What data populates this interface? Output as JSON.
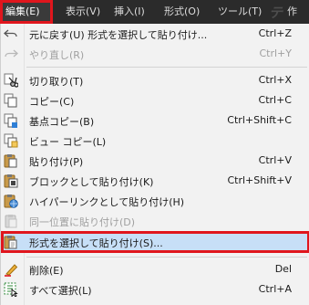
{
  "menubar": {
    "items": [
      {
        "label": "編集(E)",
        "active": true
      },
      {
        "label": "表示(V)"
      },
      {
        "label": "挿入(I)"
      },
      {
        "label": "形式(O)"
      },
      {
        "label": "ツール(T)"
      },
      {
        "label": "作"
      }
    ],
    "watermark": "テ"
  },
  "menu": {
    "items": [
      {
        "label": "元に戻す(U) 形式を選択して貼り付け...",
        "shortcut": "Ctrl+Z",
        "icon": "undo-icon",
        "enabled": true
      },
      {
        "label": "やり直し(R)",
        "shortcut": "Ctrl+Y",
        "icon": "redo-icon",
        "enabled": false
      },
      {
        "label": "切り取り(T)",
        "shortcut": "Ctrl+X",
        "icon": "scissors-icon",
        "enabled": true
      },
      {
        "label": "コピー(C)",
        "shortcut": "Ctrl+C",
        "icon": "copy-icon",
        "enabled": true
      },
      {
        "label": "基点コピー(B)",
        "shortcut": "Ctrl+Shift+C",
        "icon": "copy-with-basepoint-icon",
        "enabled": true
      },
      {
        "label": "ビュー コピー(L)",
        "shortcut": "",
        "icon": "view-copy-icon",
        "enabled": true
      },
      {
        "label": "貼り付け(P)",
        "shortcut": "Ctrl+V",
        "icon": "paste-icon",
        "enabled": true
      },
      {
        "label": "ブロックとして貼り付け(K)",
        "shortcut": "Ctrl+Shift+V",
        "icon": "paste-as-block-icon",
        "enabled": true
      },
      {
        "label": "ハイパーリンクとして貼り付け(H)",
        "shortcut": "",
        "icon": "paste-hyperlink-icon",
        "enabled": true
      },
      {
        "label": "同一位置に貼り付け(D)",
        "shortcut": "",
        "icon": "paste-original-coords-icon",
        "enabled": false
      },
      {
        "label": "形式を選択して貼り付け(S)...",
        "shortcut": "",
        "icon": "paste-special-icon",
        "enabled": true,
        "highlighted": true
      },
      {
        "label": "削除(E)",
        "shortcut": "Del",
        "icon": "eraser-icon",
        "enabled": true
      },
      {
        "label": "すべて選択(L)",
        "shortcut": "Ctrl+A",
        "icon": "select-all-icon",
        "enabled": true
      }
    ]
  },
  "colors": {
    "highlight": "#c7dff7",
    "annotation_border": "#e0161d",
    "menubar_bg": "#2b2b2b",
    "menu_bg": "#f2f2f2"
  }
}
